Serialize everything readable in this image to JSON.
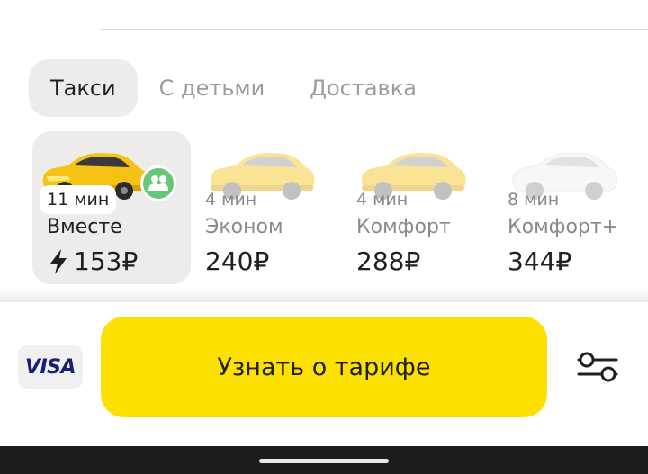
{
  "tabs": [
    {
      "label": "Такси",
      "active": true
    },
    {
      "label": "С детьми",
      "active": false
    },
    {
      "label": "Доставка",
      "active": false
    }
  ],
  "tariffs": [
    {
      "time": "11 мин",
      "name": "Вместе",
      "price": "153₽",
      "car_color": "yellow",
      "selected": true,
      "icon": "bolt-icon",
      "badge_icon": "group-icon"
    },
    {
      "time": "4 мин",
      "name": "Эконом",
      "price": "240₽",
      "car_color": "yellow",
      "selected": false
    },
    {
      "time": "4 мин",
      "name": "Комфорт",
      "price": "288₽",
      "car_color": "yellow",
      "selected": false
    },
    {
      "time": "8 мин",
      "name": "Комфорт+",
      "price": "344₽",
      "car_color": "white",
      "selected": false
    }
  ],
  "payment": {
    "label": "VISA"
  },
  "main_button": {
    "label": "Узнать о тарифе"
  },
  "colors": {
    "accent": "#fce000",
    "selected_bg": "#edecea",
    "badge_green": "#67c776",
    "visa_blue": "#1a1f71"
  }
}
